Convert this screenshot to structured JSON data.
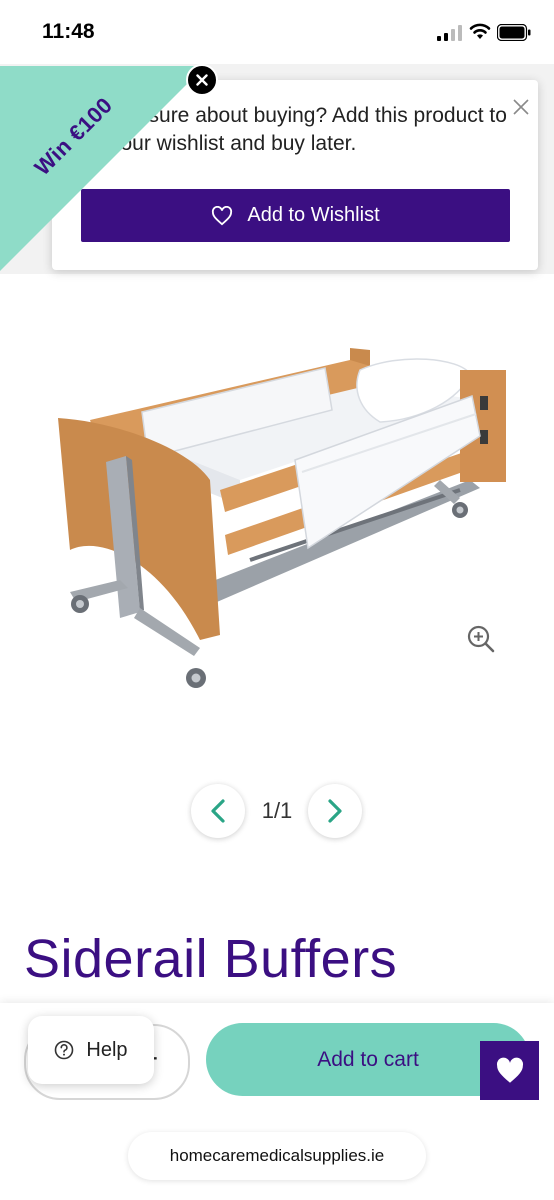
{
  "status_bar": {
    "time": "11:48"
  },
  "wishlist_popup": {
    "message": "Not sure about buying? Add this product to your wishlist and buy later.",
    "button_label": "Add to Wishlist"
  },
  "promo_ribbon": {
    "label": "Win €100"
  },
  "gallery": {
    "counter": "1/1"
  },
  "product": {
    "title": "Siderail Buffers"
  },
  "bottom_bar": {
    "qty_minus": "-",
    "help_label": "Help",
    "add_to_cart_label": "Add to cart"
  },
  "browser": {
    "url": "homecaremedicalsupplies.ie"
  },
  "colors": {
    "brand_purple": "#3b0f82",
    "accent_teal": "#76d2be",
    "ribbon_teal": "#8fdcc8"
  }
}
